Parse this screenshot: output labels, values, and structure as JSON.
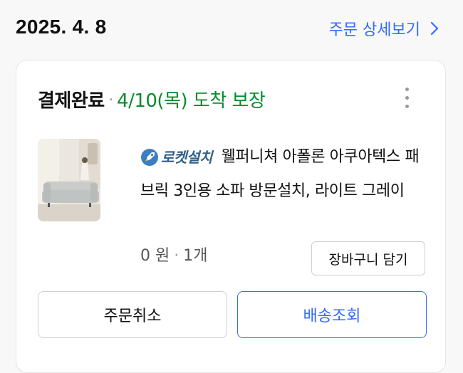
{
  "order": {
    "date": "2025. 4. 8",
    "detail_link": "주문 상세보기"
  },
  "card": {
    "status": "결제완료",
    "separator": "·",
    "delivery": "4/10(목) 도착 보장",
    "product": {
      "badge": "로켓설치",
      "title": "웰퍼니쳐 아폴론 아쿠아텍스 패브릭 3인용 소파 방문설치, 라이트 그레이",
      "price": "0 원",
      "qty": "1개"
    },
    "add_to_cart": "장바구니 담기",
    "cancel": "주문취소",
    "track": "배송조회"
  },
  "colors": {
    "link": "#346aff",
    "delivery_green": "#0a8a2c"
  },
  "icons": [
    "chevron-right-icon",
    "more-vertical-icon",
    "rocket-icon"
  ]
}
